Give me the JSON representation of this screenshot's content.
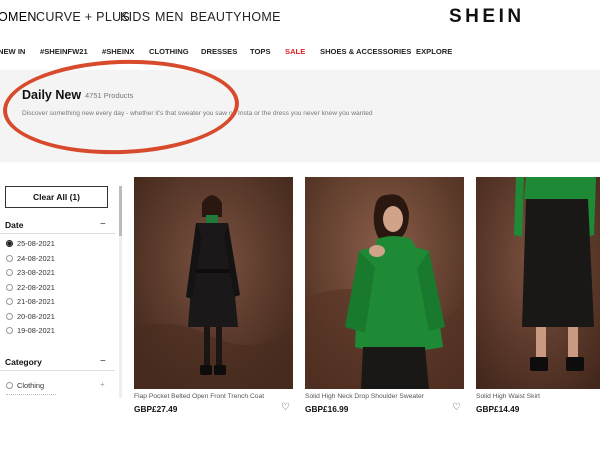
{
  "top_nav": {
    "categories": [
      {
        "label": "OMEN",
        "active": true
      },
      {
        "label": "CURVE + PLUS",
        "active": false
      },
      {
        "label": "KIDS",
        "active": false
      },
      {
        "label": "MEN",
        "active": false
      },
      {
        "label": "BEAUTY",
        "active": false
      },
      {
        "label": "HOME",
        "active": false
      }
    ],
    "logo": "SHEIN"
  },
  "sub_nav": {
    "items": [
      "NEW IN",
      "#SHEINFW21",
      "#SHEINX",
      "CLOTHING",
      "DRESSES",
      "TOPS",
      "SALE",
      "SHOES & ACCESSORIES",
      "EXPLORE"
    ],
    "sale_color": "#dd2222"
  },
  "banner": {
    "title": "Daily New",
    "count": "4751 Products",
    "description": "Discover something new every day - whether it's that sweater you saw on Insta or the dress you never knew you wanted",
    "highlight_color": "#d84a2c"
  },
  "sidebar": {
    "clear_all_label": "Clear All (1)",
    "date_heading": "Date",
    "date_toggle": "−",
    "dates": [
      {
        "label": "25-08-2021",
        "checked": true
      },
      {
        "label": "24-08-2021",
        "checked": false
      },
      {
        "label": "23-08-2021",
        "checked": false
      },
      {
        "label": "22-08-2021",
        "checked": false
      },
      {
        "label": "21-08-2021",
        "checked": false
      },
      {
        "label": "20-08-2021",
        "checked": false
      },
      {
        "label": "19-08-2021",
        "checked": false
      }
    ],
    "category_heading": "Category",
    "category_toggle": "−",
    "categories": [
      {
        "label": "Clothing",
        "toggle": "+"
      }
    ]
  },
  "products": [
    {
      "name": "Flap Pocket Belted Open Front Trench Coat",
      "price": "GBP£27.49",
      "icon": "heart-icon",
      "colors": {
        "backdrop": "#5b3a2b",
        "garment": "#1c1a1a",
        "top": "#1f7a3a"
      }
    },
    {
      "name": "Solid High Neck Drop Shoulder Sweater",
      "price": "GBP£16.99",
      "icon": "heart-icon",
      "colors": {
        "backdrop": "#6a4636",
        "garment": "#1e8a35",
        "bottom": "#1a1717"
      }
    },
    {
      "name": "Solid High Waist Skirt",
      "price": "GBP£14.49",
      "icon": "heart-icon",
      "colors": {
        "backdrop": "#5e3d2e",
        "garment": "#1a1717",
        "top": "#1e8a35"
      }
    }
  ]
}
